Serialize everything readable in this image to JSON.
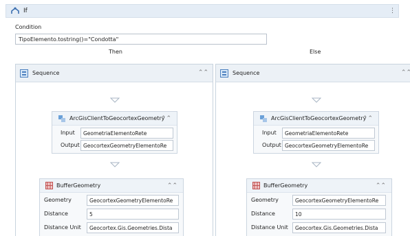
{
  "activity": {
    "title": "If",
    "condition_label": "Condition",
    "condition_value": "TipoElemento.tostring()=\"Condotta\"",
    "then_label": "Then",
    "else_label": "Else"
  },
  "branches": [
    {
      "sequence_title": "Sequence",
      "converter": {
        "title": "ArcGisClientToGeocortexGeometry",
        "input_label": "Input",
        "input_value": "GeometriaElementoRete",
        "output_label": "Output",
        "output_value": "GeocortexGeometryElementoRe"
      },
      "buffer": {
        "title": "BufferGeometry",
        "geometry_label": "Geometry",
        "geometry_value": "GeocortexGeometryElementoRe",
        "distance_label": "Distance",
        "distance_value": "5",
        "unit_label": "Distance Unit",
        "unit_value": "Geocortex.Gis.Geometries.Dista"
      }
    },
    {
      "sequence_title": "Sequence",
      "converter": {
        "title": "ArcGisClientToGeocortexGeometry",
        "input_label": "Input",
        "input_value": "GeometriaElementoRete",
        "output_label": "Output",
        "output_value": "GeocortexGeometryElementoRe"
      },
      "buffer": {
        "title": "BufferGeometry",
        "geometry_label": "Geometry",
        "geometry_value": "GeocortexGeometryElementoRe",
        "distance_label": "Distance",
        "distance_value": "10",
        "unit_label": "Distance Unit",
        "unit_value": "Geocortex.Gis.Geometries.Dista"
      }
    }
  ],
  "icons": {
    "if": "if-branch-icon",
    "sequence": "sequence-icon",
    "converter": "convert-activity-icon",
    "buffer": "buffer-geometry-icon",
    "collapse": "double-chevron-up-icon",
    "drop": "drop-target-arrow-icon"
  }
}
